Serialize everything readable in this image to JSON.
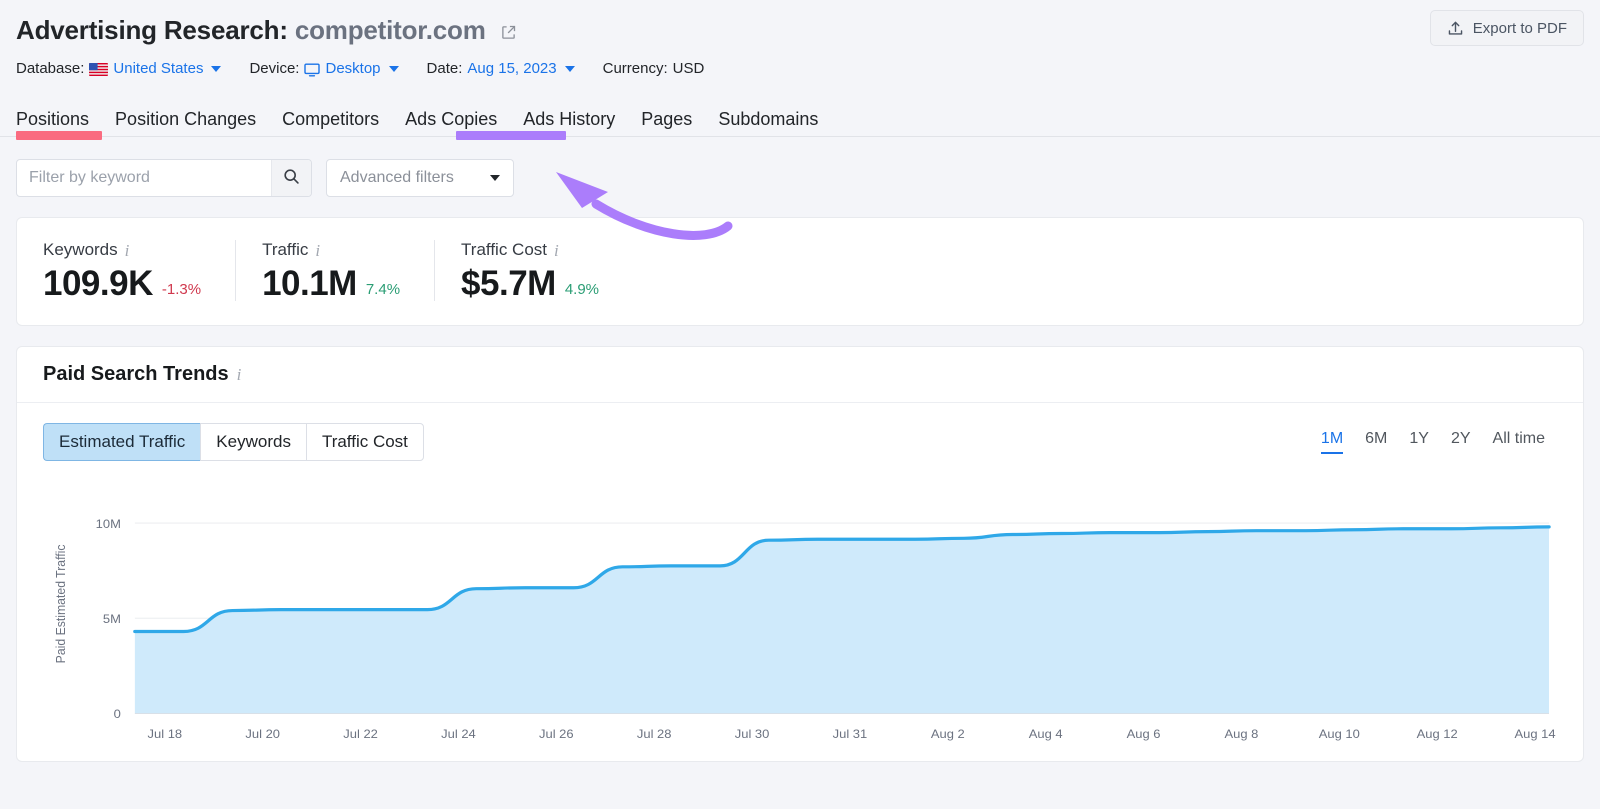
{
  "header": {
    "title_prefix": "Advertising Research:",
    "domain": "competitor.com",
    "export_label": "Export to PDF",
    "meta": {
      "database_label": "Database:",
      "database_value": "United States",
      "device_label": "Device:",
      "device_value": "Desktop",
      "date_label": "Date:",
      "date_value": "Aug 15, 2023",
      "currency_label": "Currency:",
      "currency_value": "USD"
    }
  },
  "tabs": [
    {
      "label": "Positions",
      "highlight": "#fa6b80"
    },
    {
      "label": "Position Changes",
      "highlight": ""
    },
    {
      "label": "Competitors",
      "highlight": ""
    },
    {
      "label": "Ads Copies",
      "highlight": "#ab7dfb"
    },
    {
      "label": "Ads History",
      "highlight": ""
    },
    {
      "label": "Pages",
      "highlight": ""
    },
    {
      "label": "Subdomains",
      "highlight": ""
    }
  ],
  "annotation": {
    "arrow_color": "#ab7dfb",
    "points_to": "Ads Copies"
  },
  "filters": {
    "search_placeholder": "Filter by keyword",
    "search_value": "",
    "advanced_filters_label": "Advanced filters"
  },
  "metrics": [
    {
      "label": "Keywords",
      "value": "109.9K",
      "delta": "-1.3%",
      "direction": "down"
    },
    {
      "label": "Traffic",
      "value": "10.1M",
      "delta": "7.4%",
      "direction": "up"
    },
    {
      "label": "Traffic Cost",
      "value": "$5.7M",
      "delta": "4.9%",
      "direction": "up"
    }
  ],
  "trends": {
    "title": "Paid Search Trends",
    "metric_tabs": [
      {
        "label": "Estimated Traffic",
        "active": true
      },
      {
        "label": "Keywords",
        "active": false
      },
      {
        "label": "Traffic Cost",
        "active": false
      }
    ],
    "ranges": [
      {
        "label": "1M",
        "active": true
      },
      {
        "label": "6M",
        "active": false
      },
      {
        "label": "1Y",
        "active": false
      },
      {
        "label": "2Y",
        "active": false
      },
      {
        "label": "All time",
        "active": false
      }
    ]
  },
  "chart_data": {
    "type": "area",
    "title": "Paid Search Trends",
    "xlabel": "",
    "ylabel": "Paid Estimated Traffic",
    "ylim": [
      0,
      11500000
    ],
    "ytick_values": [
      0,
      5000000,
      10000000
    ],
    "ytick_labels": [
      "0",
      "5M",
      "10M"
    ],
    "grid": true,
    "legend": "none",
    "line_color": "#2fa8e8",
    "fill_color": "#cfeafb",
    "x_tick_labels": [
      "Jul 18",
      "Jul 20",
      "Jul 22",
      "Jul 24",
      "Jul 26",
      "Jul 28",
      "Jul 30",
      "Jul 31",
      "Aug 2",
      "Aug 4",
      "Aug 6",
      "Aug 8",
      "Aug 10",
      "Aug 12",
      "Aug 14"
    ],
    "x": [
      "Jul 16",
      "Jul 17",
      "Jul 18",
      "Jul 19",
      "Jul 20",
      "Jul 21",
      "Jul 22",
      "Jul 23",
      "Jul 24",
      "Jul 25",
      "Jul 26",
      "Jul 27",
      "Jul 28",
      "Jul 29",
      "Jul 30",
      "Jul 31",
      "Aug 1",
      "Aug 2",
      "Aug 3",
      "Aug 4",
      "Aug 5",
      "Aug 6",
      "Aug 7",
      "Aug 8",
      "Aug 9",
      "Aug 10",
      "Aug 11",
      "Aug 12",
      "Aug 13",
      "Aug 14"
    ],
    "series": [
      {
        "name": "Paid Estimated Traffic",
        "values": [
          4300000,
          4300000,
          5400000,
          5450000,
          5450000,
          5450000,
          5450000,
          6550000,
          6600000,
          6600000,
          7700000,
          7750000,
          7750000,
          9100000,
          9150000,
          9150000,
          9150000,
          9200000,
          9400000,
          9450000,
          9500000,
          9500000,
          9550000,
          9600000,
          9600000,
          9650000,
          9700000,
          9700000,
          9750000,
          9800000
        ]
      }
    ]
  }
}
